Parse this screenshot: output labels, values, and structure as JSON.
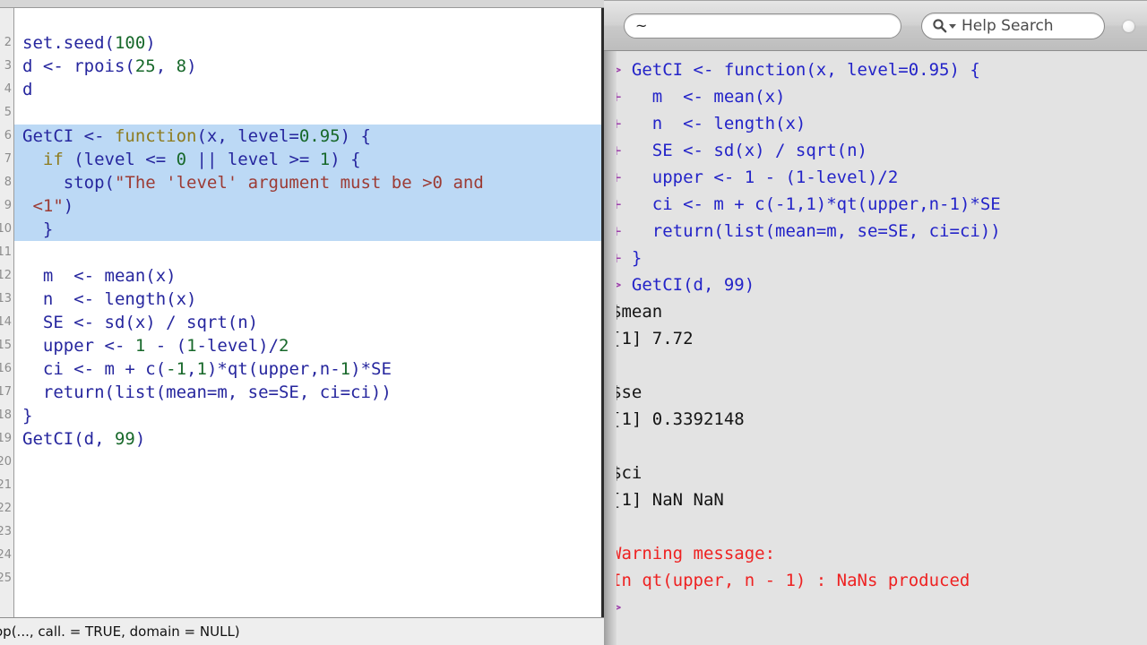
{
  "editor": {
    "gutter_numbers": [
      "2",
      "3",
      "4",
      "5",
      "6",
      "7",
      "8",
      "9",
      "10",
      "11",
      "12",
      "13",
      "14",
      "15",
      "16",
      "17",
      "18",
      "19",
      "20",
      "21",
      "22",
      "23",
      "24",
      "25"
    ],
    "lines": [
      {
        "highlighted": false,
        "tokens": [
          {
            "t": "set.seed(",
            "c": "id"
          },
          {
            "t": "100",
            "c": "num"
          },
          {
            "t": ")",
            "c": "id"
          }
        ]
      },
      {
        "highlighted": false,
        "tokens": [
          {
            "t": "d <- rpois(",
            "c": "id"
          },
          {
            "t": "25",
            "c": "num"
          },
          {
            "t": ", ",
            "c": "id"
          },
          {
            "t": "8",
            "c": "num"
          },
          {
            "t": ")",
            "c": "id"
          }
        ]
      },
      {
        "highlighted": false,
        "tokens": [
          {
            "t": "d",
            "c": "id"
          }
        ]
      },
      {
        "highlighted": false,
        "tokens": [
          {
            "t": "",
            "c": "id"
          }
        ]
      },
      {
        "highlighted": true,
        "tokens": [
          {
            "t": "GetCI <- ",
            "c": "id"
          },
          {
            "t": "function",
            "c": "fn"
          },
          {
            "t": "(x, level=",
            "c": "id"
          },
          {
            "t": "0.95",
            "c": "num"
          },
          {
            "t": ") {",
            "c": "id"
          }
        ]
      },
      {
        "highlighted": true,
        "tokens": [
          {
            "t": "  ",
            "c": "id"
          },
          {
            "t": "if",
            "c": "kw"
          },
          {
            "t": " (level <= ",
            "c": "id"
          },
          {
            "t": "0",
            "c": "num"
          },
          {
            "t": " || level >= ",
            "c": "id"
          },
          {
            "t": "1",
            "c": "num"
          },
          {
            "t": ") {",
            "c": "id"
          }
        ]
      },
      {
        "highlighted": true,
        "tokens": [
          {
            "t": "    stop(",
            "c": "id"
          },
          {
            "t": "\"The 'level' argument must be >0 and",
            "c": "str"
          }
        ]
      },
      {
        "highlighted": true,
        "tokens": [
          {
            "t": " ",
            "c": "id"
          },
          {
            "t": "<1\"",
            "c": "str"
          },
          {
            "t": ")",
            "c": "id"
          }
        ]
      },
      {
        "highlighted": true,
        "tokens": [
          {
            "t": "  }",
            "c": "id"
          }
        ]
      },
      {
        "highlighted": false,
        "tokens": [
          {
            "t": "",
            "c": "id"
          }
        ]
      },
      {
        "highlighted": false,
        "tokens": [
          {
            "t": "  m  <- mean(x)",
            "c": "id"
          }
        ]
      },
      {
        "highlighted": false,
        "tokens": [
          {
            "t": "  n  <- length(x)",
            "c": "id"
          }
        ]
      },
      {
        "highlighted": false,
        "tokens": [
          {
            "t": "  SE <- sd(x) / sqrt(n)",
            "c": "id"
          }
        ]
      },
      {
        "highlighted": false,
        "tokens": [
          {
            "t": "  upper <- ",
            "c": "id"
          },
          {
            "t": "1",
            "c": "num"
          },
          {
            "t": " - (",
            "c": "id"
          },
          {
            "t": "1",
            "c": "num"
          },
          {
            "t": "-level)/",
            "c": "id"
          },
          {
            "t": "2",
            "c": "num"
          }
        ]
      },
      {
        "highlighted": false,
        "tokens": [
          {
            "t": "  ci <- m + c(",
            "c": "id"
          },
          {
            "t": "-1",
            "c": "num"
          },
          {
            "t": ",",
            "c": "id"
          },
          {
            "t": "1",
            "c": "num"
          },
          {
            "t": ")*qt(upper,n-",
            "c": "id"
          },
          {
            "t": "1",
            "c": "num"
          },
          {
            "t": ")*SE",
            "c": "id"
          }
        ]
      },
      {
        "highlighted": false,
        "tokens": [
          {
            "t": "  return(list(mean=m, se=SE, ci=ci))",
            "c": "id"
          }
        ]
      },
      {
        "highlighted": false,
        "tokens": [
          {
            "t": "}",
            "c": "id"
          }
        ]
      },
      {
        "highlighted": false,
        "tokens": [
          {
            "t": "GetCI(d, ",
            "c": "id"
          },
          {
            "t": "99",
            "c": "num"
          },
          {
            "t": ")",
            "c": "id"
          }
        ]
      }
    ],
    "status_text": "op(..., call. = TRUE, domain = NULL)"
  },
  "console": {
    "toolbar": {
      "path_value": "~",
      "path_placeholder": "~",
      "help_search_label": "Help Search",
      "search_icon": "magnifier-icon",
      "caret_icon": "chevron-down-icon",
      "window_dot": "resize-handle-dot"
    },
    "lines": [
      {
        "prompt": "> ",
        "kind": "input",
        "text": "GetCI <- function(x, level=0.95) {"
      },
      {
        "prompt": "+ ",
        "kind": "input",
        "text": "  m  <- mean(x)"
      },
      {
        "prompt": "+ ",
        "kind": "input",
        "text": "  n  <- length(x)"
      },
      {
        "prompt": "+ ",
        "kind": "input",
        "text": "  SE <- sd(x) / sqrt(n)"
      },
      {
        "prompt": "+ ",
        "kind": "input",
        "text": "  upper <- 1 - (1-level)/2"
      },
      {
        "prompt": "+ ",
        "kind": "input",
        "text": "  ci <- m + c(-1,1)*qt(upper,n-1)*SE"
      },
      {
        "prompt": "+ ",
        "kind": "input",
        "text": "  return(list(mean=m, se=SE, ci=ci))"
      },
      {
        "prompt": "+ ",
        "kind": "input",
        "text": "}"
      },
      {
        "prompt": "> ",
        "kind": "input",
        "text": "GetCI(d, 99)"
      },
      {
        "prompt": "",
        "kind": "output",
        "text": "$mean"
      },
      {
        "prompt": "",
        "kind": "output",
        "text": "[1] 7.72"
      },
      {
        "prompt": "",
        "kind": "blank",
        "text": " "
      },
      {
        "prompt": "",
        "kind": "output",
        "text": "$se"
      },
      {
        "prompt": "",
        "kind": "output",
        "text": "[1] 0.3392148"
      },
      {
        "prompt": "",
        "kind": "blank",
        "text": " "
      },
      {
        "prompt": "",
        "kind": "output",
        "text": "$ci"
      },
      {
        "prompt": "",
        "kind": "output",
        "text": "[1] NaN NaN"
      },
      {
        "prompt": "",
        "kind": "blank",
        "text": " "
      },
      {
        "prompt": "",
        "kind": "warn",
        "text": "Warning message:"
      },
      {
        "prompt": "",
        "kind": "warn",
        "text": "In qt(upper, n - 1) : NaNs produced"
      },
      {
        "prompt": "> ",
        "kind": "input",
        "text": ""
      }
    ]
  },
  "colors": {
    "highlight_blue": "#bcd9f5",
    "code_blue": "#1a1a7a",
    "string_red": "#9c3b34",
    "number_green": "#17682a",
    "function_olive": "#8d7b1e",
    "console_input_blue": "#2323c8",
    "console_prompt_magenta": "#9c3faa",
    "console_warning_red": "#ee2222",
    "console_bg": "#e3e3e3",
    "editor_bg": "#ffffff"
  }
}
